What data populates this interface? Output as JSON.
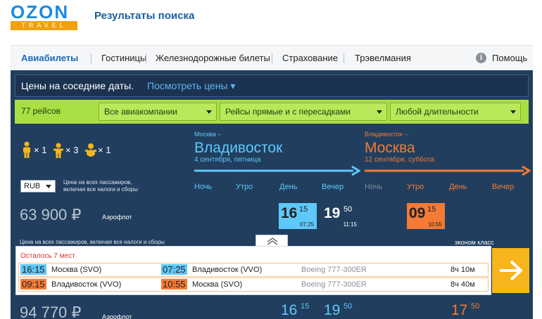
{
  "header": {
    "logo_main": "OZON",
    "logo_sub": "TRAVEL",
    "title": "Результаты поиска"
  },
  "nav": {
    "items": [
      "Авиабилеты",
      "Гостиницы",
      "Железнодорожные билеты",
      "Страхование",
      "Трэвелмания"
    ],
    "help_icon": "i",
    "help": "Помощь"
  },
  "nearby": {
    "text": "Цены на соседние даты.",
    "link": "Посмотреть цены ▾"
  },
  "filters": {
    "count": "77 рейсов",
    "airlines": "Все авиакомпании",
    "flights": "Рейсы прямые и с пересадками",
    "duration": "Любой длительности"
  },
  "passengers": {
    "adults": "× 1",
    "children": "× 3",
    "infants": "× 1"
  },
  "currency": "RUB",
  "price_note": "Цена на всех пассажиров, включая все налоги и сборы",
  "outbound": {
    "from": "Москва –",
    "to": "Владивосток",
    "date": "4 сентября, пятница",
    "color": "#5ec8fa"
  },
  "return": {
    "from": "Владивосток –",
    "to": "Москва",
    "date": "12 сентября, суббота",
    "color": "#f47a35"
  },
  "times_of_day": [
    "Ночь",
    "Утро",
    "День",
    "Вечер"
  ],
  "offer1": {
    "price": "63 900 ₽",
    "airline": "Аэрофлот",
    "dep1_h": "16",
    "dep1_m": "15",
    "dep1_arr": "07:25",
    "dep2_h": "19",
    "dep2_m": "50",
    "dep2_arr": "11:15",
    "ret1_h": "09",
    "ret1_m": "15",
    "ret1_arr": "10:55"
  },
  "card": {
    "note": "Цена на всех пассажиров, включая все налоги и сборы",
    "class": "эконом класс",
    "seats_left": "Осталось 7 мест",
    "seg1": {
      "dep": "16:15",
      "from": "Москва (SVO)",
      "arr": "07:25",
      "to": "Владивосток (VVO)",
      "aircraft": "Boeing 777-300ER",
      "duration": "8ч 10м"
    },
    "seg2": {
      "dep": "09:15",
      "from": "Владивосток (VVO)",
      "arr": "10:55",
      "to": "Москва (SVO)",
      "aircraft": "Boeing 777-300ER",
      "duration": "8ч 40м"
    }
  },
  "offer2": {
    "price": "94 770 ₽",
    "airline": "Аэрофлот",
    "dep1_h": "16",
    "dep1_m": "15",
    "dep2_h": "19",
    "dep2_m": "50",
    "ret1_h": "17",
    "ret1_m": "50"
  },
  "colors": {
    "blue_accent": "#5ec8fa",
    "orange_accent": "#f47a35",
    "green_bar": "#a9df43",
    "panel": "#213e5e",
    "cta": "#f6b51b"
  }
}
